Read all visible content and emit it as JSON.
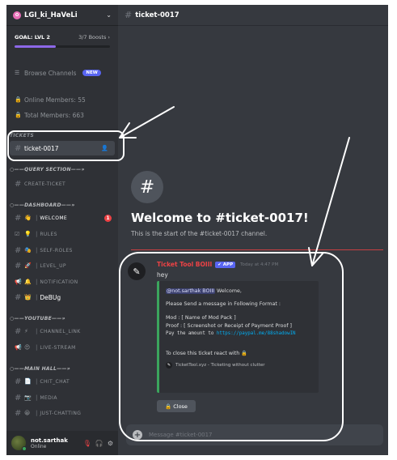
{
  "server": {
    "name": "LGI_ki_HaVeLi",
    "icon": "server-avatar-icon"
  },
  "goal": {
    "label": "GOAL: LVL 2",
    "boosts": "3/7 Boosts",
    "progress": 0.43
  },
  "sidebar": {
    "browse": {
      "label": "Browse Channels",
      "badge": "NEW"
    },
    "online": "Online Members: 55",
    "total": "Total Members: 663",
    "tickets_category": "TICKETS",
    "ticket_channel": "ticket-0017",
    "query_category": "○——QUERY SECTION——»",
    "create_ticket": "CREATE-TICKET",
    "dashboard_category": "○——DASHBOARD——»",
    "welcome": "WELCOME",
    "welcome_badge": "1",
    "rules": "RULES",
    "self_roles": "SELF-ROLES",
    "level_up": "LEVEL_UP",
    "notification": "NOTIFICATION",
    "debug": "DeBUg",
    "youtube_category": "○——YOUTUBE——»",
    "channel_link": "CHANNEL_LINK",
    "live_stream": "LIVE-STREAM",
    "main_hall_category": "○——MAIN HALL——»",
    "chit_chat": "CHIT_CHAT",
    "media": "MEDIA",
    "just_chatting": "JUST-CHATTING"
  },
  "user": {
    "name": "not.sarthak",
    "status": "Online"
  },
  "header": {
    "channel": "ticket-0017"
  },
  "welcome": {
    "title": "Welcome to #ticket-0017!",
    "subtitle": "This is the start of the #ticket-0017 channel."
  },
  "message": {
    "author": "Ticket Tool BOIII",
    "app_tag": "✔ APP",
    "time": "Today at 4:47 PM",
    "text": "hey",
    "embed": {
      "mention": "@not.sarthak BOIII",
      "line1_rest": " Welcome,",
      "line2": "Please Send a message in Following Format :",
      "line3": "Mod : [ Name of Mod Pack ]",
      "line4": "Proof : [ Screenshot or Receipt of Payment Proof ]",
      "line5_prefix": "Pay the amount to ",
      "line5_link": "https://paypal.me/88shadowIN",
      "line6": "To close this ticket react with 🔒",
      "footer": "TicketTool.xyz - Ticketing without clutter"
    },
    "close_button": "Close"
  },
  "composer": {
    "placeholder": "Message #ticket-0017"
  },
  "colors": {
    "accent": "#5865f2",
    "embed_border": "#3ba55d",
    "author": "#ed4245",
    "boost": "#8d68e8"
  }
}
